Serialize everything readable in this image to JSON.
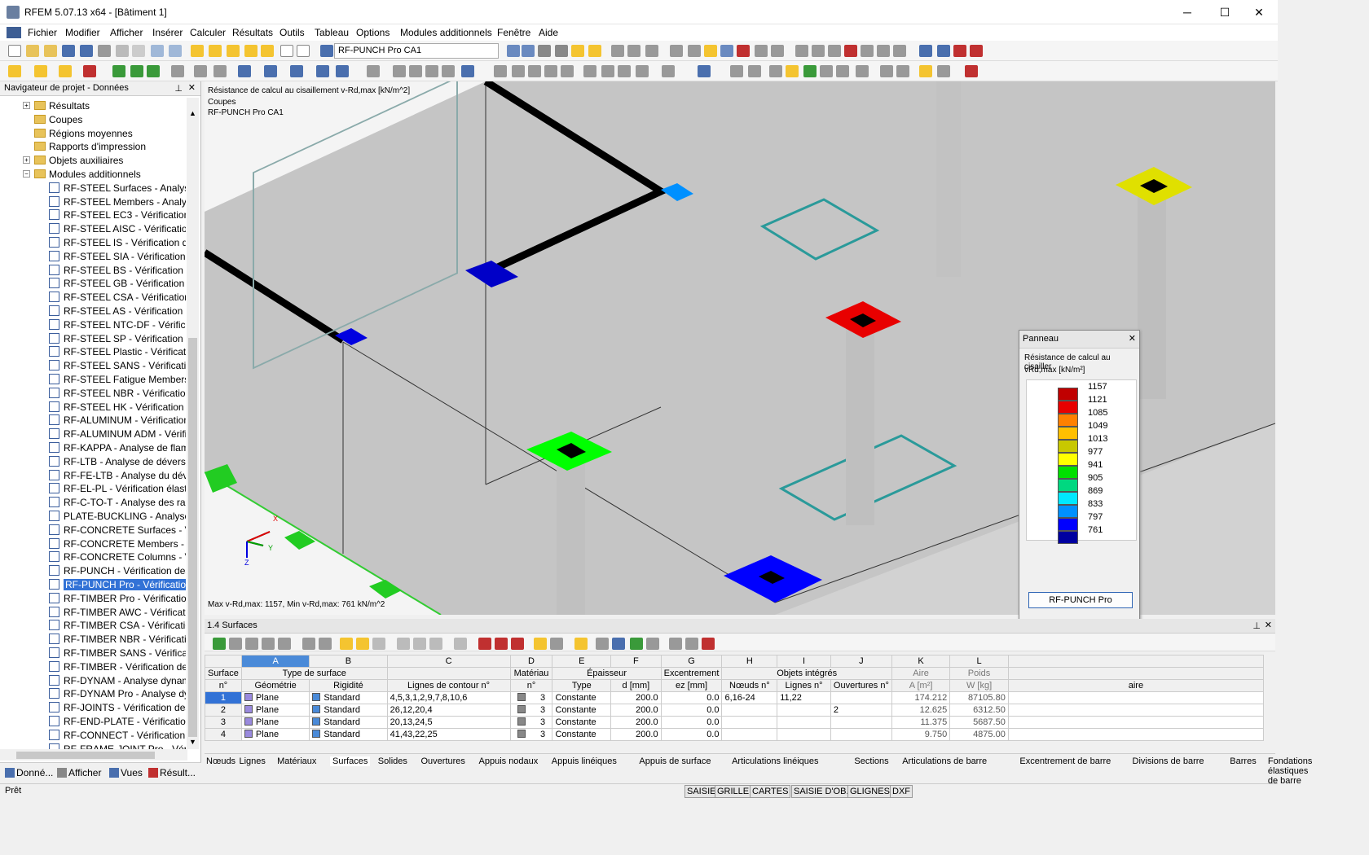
{
  "window": {
    "title": "RFEM 5.07.13 x64 - [Bâtiment 1]",
    "minimize": "─",
    "maximize": "☐",
    "close": "✕"
  },
  "menu": [
    "Fichier",
    "Modifier",
    "Afficher",
    "Insérer",
    "Calculer",
    "Résultats",
    "Outils",
    "Tableau",
    "Options",
    "Modules additionnels",
    "Fenêtre",
    "Aide"
  ],
  "toolbar": {
    "combo_value": "RF-PUNCH Pro CA1"
  },
  "navigator": {
    "title": "Navigateur de projet - Données",
    "items": [
      {
        "label": "Résultats",
        "type": "folder",
        "expanded": true
      },
      {
        "label": "Coupes",
        "type": "folder"
      },
      {
        "label": "Régions moyennes",
        "type": "folder"
      },
      {
        "label": "Rapports d'impression",
        "type": "folder"
      },
      {
        "label": "Objets auxiliaires",
        "type": "folder",
        "expanded": true
      },
      {
        "label": "Modules additionnels",
        "type": "folder",
        "expanded": false
      },
      {
        "label": "RF-STEEL Surfaces - Analyse g",
        "type": "module"
      },
      {
        "label": "RF-STEEL Members - Analyse",
        "type": "module"
      },
      {
        "label": "RF-STEEL EC3 - Vérification de",
        "type": "module"
      },
      {
        "label": "RF-STEEL AISC - Vérification c",
        "type": "module"
      },
      {
        "label": "RF-STEEL IS - Vérification des",
        "type": "module"
      },
      {
        "label": "RF-STEEL SIA - Vérification de",
        "type": "module"
      },
      {
        "label": "RF-STEEL BS - Vérification des",
        "type": "module"
      },
      {
        "label": "RF-STEEL GB - Vérification de",
        "type": "module"
      },
      {
        "label": "RF-STEEL CSA - Vérification d",
        "type": "module"
      },
      {
        "label": "RF-STEEL AS - Vérification des",
        "type": "module"
      },
      {
        "label": "RF-STEEL NTC-DF - Vérificati",
        "type": "module"
      },
      {
        "label": "RF-STEEL SP - Vérification des",
        "type": "module"
      },
      {
        "label": "RF-STEEL Plastic - Vérification",
        "type": "module"
      },
      {
        "label": "RF-STEEL SANS - Vérification",
        "type": "module"
      },
      {
        "label": "RF-STEEL Fatigue Members -",
        "type": "module"
      },
      {
        "label": "RF-STEEL NBR - Vérification d",
        "type": "module"
      },
      {
        "label": "RF-STEEL HK - Vérification de",
        "type": "module"
      },
      {
        "label": "RF-ALUMINUM - Vérification",
        "type": "module"
      },
      {
        "label": "RF-ALUMINUM ADM - Vérific",
        "type": "module"
      },
      {
        "label": "RF-KAPPA - Analyse de flamb",
        "type": "module"
      },
      {
        "label": "RF-LTB - Analyse de déversen",
        "type": "module"
      },
      {
        "label": "RF-FE-LTB - Analyse du déver",
        "type": "module"
      },
      {
        "label": "RF-EL-PL - Vérification élastiq",
        "type": "module"
      },
      {
        "label": "RF-C-TO-T - Analyse des rapp",
        "type": "module"
      },
      {
        "label": "PLATE-BUCKLING - Analyse d",
        "type": "module"
      },
      {
        "label": "RF-CONCRETE Surfaces - Véri",
        "type": "module"
      },
      {
        "label": "RF-CONCRETE Members - Ca",
        "type": "module"
      },
      {
        "label": "RF-CONCRETE Columns - Vér",
        "type": "module"
      },
      {
        "label": "RF-PUNCH - Vérification des",
        "type": "module"
      },
      {
        "label": "RF-PUNCH Pro - Vérification",
        "type": "module",
        "selected": true
      },
      {
        "label": "RF-TIMBER Pro - Vérification",
        "type": "module"
      },
      {
        "label": "RF-TIMBER AWC - Vérificatio",
        "type": "module"
      },
      {
        "label": "RF-TIMBER CSA - Vérification",
        "type": "module"
      },
      {
        "label": "RF-TIMBER NBR - Vérification",
        "type": "module"
      },
      {
        "label": "RF-TIMBER SANS - Vérificatio",
        "type": "module"
      },
      {
        "label": "RF-TIMBER - Vérification des l",
        "type": "module"
      },
      {
        "label": "RF-DYNAM - Analyse dynami",
        "type": "module"
      },
      {
        "label": "RF-DYNAM Pro - Analyse dyn",
        "type": "module"
      },
      {
        "label": "RF-JOINTS - Vérification des a",
        "type": "module"
      },
      {
        "label": "RF-END-PLATE - Vérification",
        "type": "module"
      },
      {
        "label": "RF-CONNECT - Vérification d",
        "type": "module"
      },
      {
        "label": "RF-FRAME-JOINT Pro - Vérific",
        "type": "module"
      }
    ],
    "tabs": [
      "Donné...",
      "Afficher",
      "Vues",
      "Résult..."
    ]
  },
  "viewport": {
    "line1": "Résistance de calcul au cisaillement v-Rd,max [kN/m^2]",
    "line2": "Coupes",
    "line3": "RF-PUNCH Pro CA1",
    "footer": "Max v-Rd,max: 1157, Min v-Rd,max: 761 kN/m^2",
    "axis_x": "X",
    "axis_y": "Y",
    "axis_z": "Z"
  },
  "panel": {
    "title": "Panneau",
    "desc": "Résistance de calcul au cisailler",
    "unit": "vRd,max [kN/m²]",
    "button": "RF-PUNCH Pro",
    "legend": [
      {
        "value": "1157",
        "color": "#c00000"
      },
      {
        "value": "1121",
        "color": "#e80000"
      },
      {
        "value": "1085",
        "color": "#ff8000"
      },
      {
        "value": "1049",
        "color": "#ffbf00"
      },
      {
        "value": "1013",
        "color": "#c8c800"
      },
      {
        "value": "977",
        "color": "#ffff00"
      },
      {
        "value": "941",
        "color": "#00e000"
      },
      {
        "value": "905",
        "color": "#00d880"
      },
      {
        "value": "869",
        "color": "#00e8ff"
      },
      {
        "value": "833",
        "color": "#0090ff"
      },
      {
        "value": "797",
        "color": "#0000ff"
      },
      {
        "value": "761",
        "color": "#0000a0"
      }
    ]
  },
  "table": {
    "title": "1.4 Surfaces",
    "col_letters": [
      "A",
      "B",
      "C",
      "D",
      "E",
      "F",
      "G",
      "H",
      "I",
      "J",
      "K",
      "L"
    ],
    "group_headers": {
      "surface": "Surface",
      "surface_no": "n°",
      "type": "Type de surface",
      "geometry": "Géométrie",
      "stiffness": "Rigidité",
      "contour": "Lignes de contour n°",
      "material": "Matériau",
      "material_no": "n°",
      "thickness": "Épaisseur",
      "th_type": "Type",
      "th_d": "d [mm]",
      "eccentricity": "Excentrement",
      "ecc_ez": "ez [mm]",
      "integrated": "Objets intégrés",
      "nodes": "Nœuds n°",
      "lines": "Lignes n°",
      "openings": "Ouvertures n°",
      "area": "Aire",
      "area_unit": "A [m²]",
      "weight": "Poids",
      "weight_unit": "W [kg]",
      "comment": "aire"
    },
    "rows": [
      {
        "no": "1",
        "geom": "Plane",
        "stiff": "Standard",
        "lines": "4,5,3,1,2,9,7,8,10,6",
        "mat": "3",
        "ttype": "Constante",
        "d": "200.0",
        "ez": "0.0",
        "nodes": "6,16-24",
        "ilines": "11,22",
        "open": "",
        "area": "174.212",
        "weight": "87105.80"
      },
      {
        "no": "2",
        "geom": "Plane",
        "stiff": "Standard",
        "lines": "26,12,20,4",
        "mat": "3",
        "ttype": "Constante",
        "d": "200.0",
        "ez": "0.0",
        "nodes": "",
        "ilines": "",
        "open": "2",
        "area": "12.625",
        "weight": "6312.50"
      },
      {
        "no": "3",
        "geom": "Plane",
        "stiff": "Standard",
        "lines": "20,13,24,5",
        "mat": "3",
        "ttype": "Constante",
        "d": "200.0",
        "ez": "0.0",
        "nodes": "",
        "ilines": "",
        "open": "",
        "area": "11.375",
        "weight": "5687.50"
      },
      {
        "no": "4",
        "geom": "Plane",
        "stiff": "Standard",
        "lines": "41,43,22,25",
        "mat": "3",
        "ttype": "Constante",
        "d": "200.0",
        "ez": "0.0",
        "nodes": "",
        "ilines": "",
        "open": "",
        "area": "9.750",
        "weight": "4875.00"
      }
    ]
  },
  "bottom_tabs": [
    "Nœuds",
    "Lignes",
    "Matériaux",
    "Surfaces",
    "Solides",
    "Ouvertures",
    "Appuis nodaux",
    "Appuis linéiques",
    "Appuis de surface",
    "Articulations linéiques",
    "Sections",
    "Articulations de barre",
    "Excentrement de barre",
    "Divisions de barre",
    "Barres",
    "Fondations élastiques de barre"
  ],
  "status": {
    "text": "Prêt",
    "buttons": [
      "SAISIE",
      "GRILLE",
      "CARTES",
      "SAISIE D'OB.",
      "GLIGNES",
      "DXF"
    ]
  }
}
